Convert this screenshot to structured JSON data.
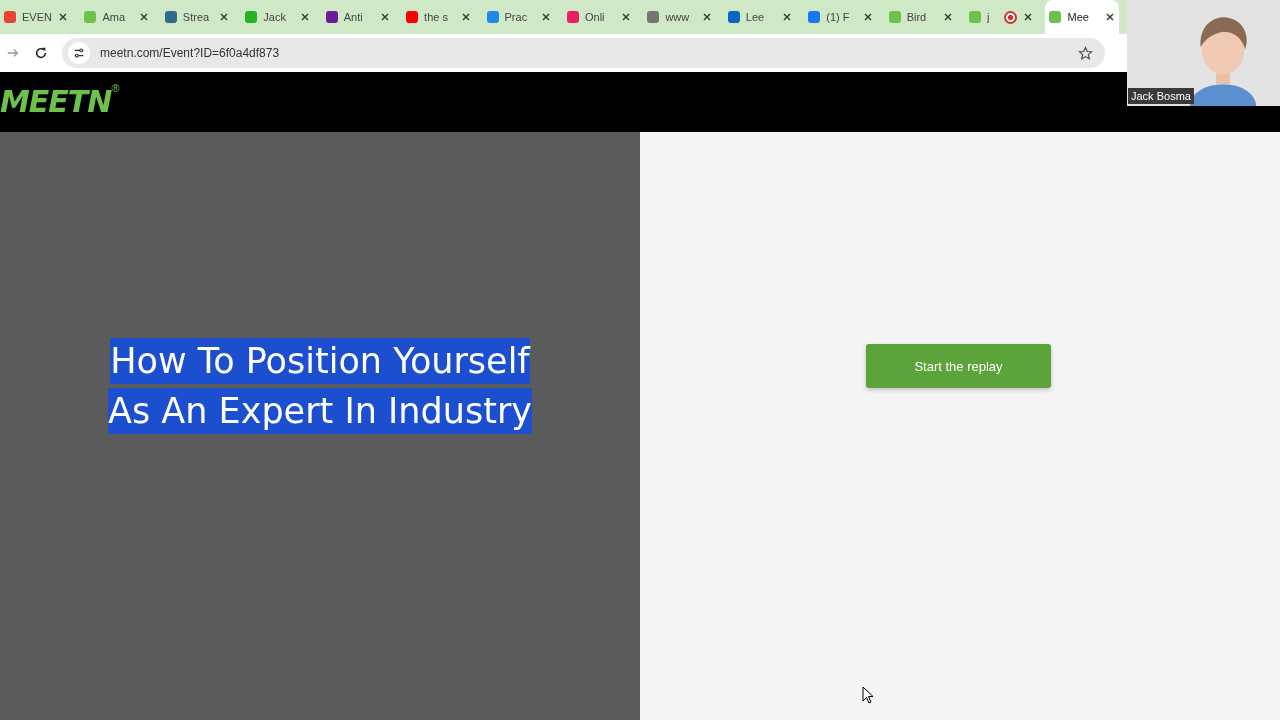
{
  "browser": {
    "tabs": [
      {
        "title": "EVEN",
        "color": "#ea4335",
        "selected": false,
        "recording": false
      },
      {
        "title": "Ama",
        "color": "#6cc24a",
        "selected": false,
        "recording": false
      },
      {
        "title": "Strea",
        "color": "#2f6b8a",
        "selected": false,
        "recording": false
      },
      {
        "title": "Jack",
        "color": "#22b422",
        "selected": false,
        "recording": false
      },
      {
        "title": "Anti",
        "color": "#6a1b9a",
        "selected": false,
        "recording": false
      },
      {
        "title": "the s",
        "color": "#ff0000",
        "selected": false,
        "recording": false
      },
      {
        "title": "Prac",
        "color": "#1e88e5",
        "selected": false,
        "recording": false
      },
      {
        "title": "Onli",
        "color": "#e91e63",
        "selected": false,
        "recording": false
      },
      {
        "title": "www",
        "color": "#757575",
        "selected": false,
        "recording": false
      },
      {
        "title": "Lee",
        "color": "#0a66c2",
        "selected": false,
        "recording": false
      },
      {
        "title": "(1) F",
        "color": "#1877f2",
        "selected": false,
        "recording": false
      },
      {
        "title": "Bird",
        "color": "#6cc24a",
        "selected": false,
        "recording": false
      },
      {
        "title": "j",
        "color": "#6cc24a",
        "selected": false,
        "recording": true
      },
      {
        "title": "Mee",
        "color": "#6cc24a",
        "selected": true,
        "recording": false
      }
    ],
    "url": "meetn.com/Event?ID=6f0a4df873"
  },
  "header": {
    "logo": "MEETN",
    "registered": "®"
  },
  "event": {
    "title": "How To Position Yourself As An Expert In Industry",
    "highlighted": true
  },
  "replay_button": "Start the replay",
  "video_overlay": {
    "name": "Jack Bosma"
  }
}
